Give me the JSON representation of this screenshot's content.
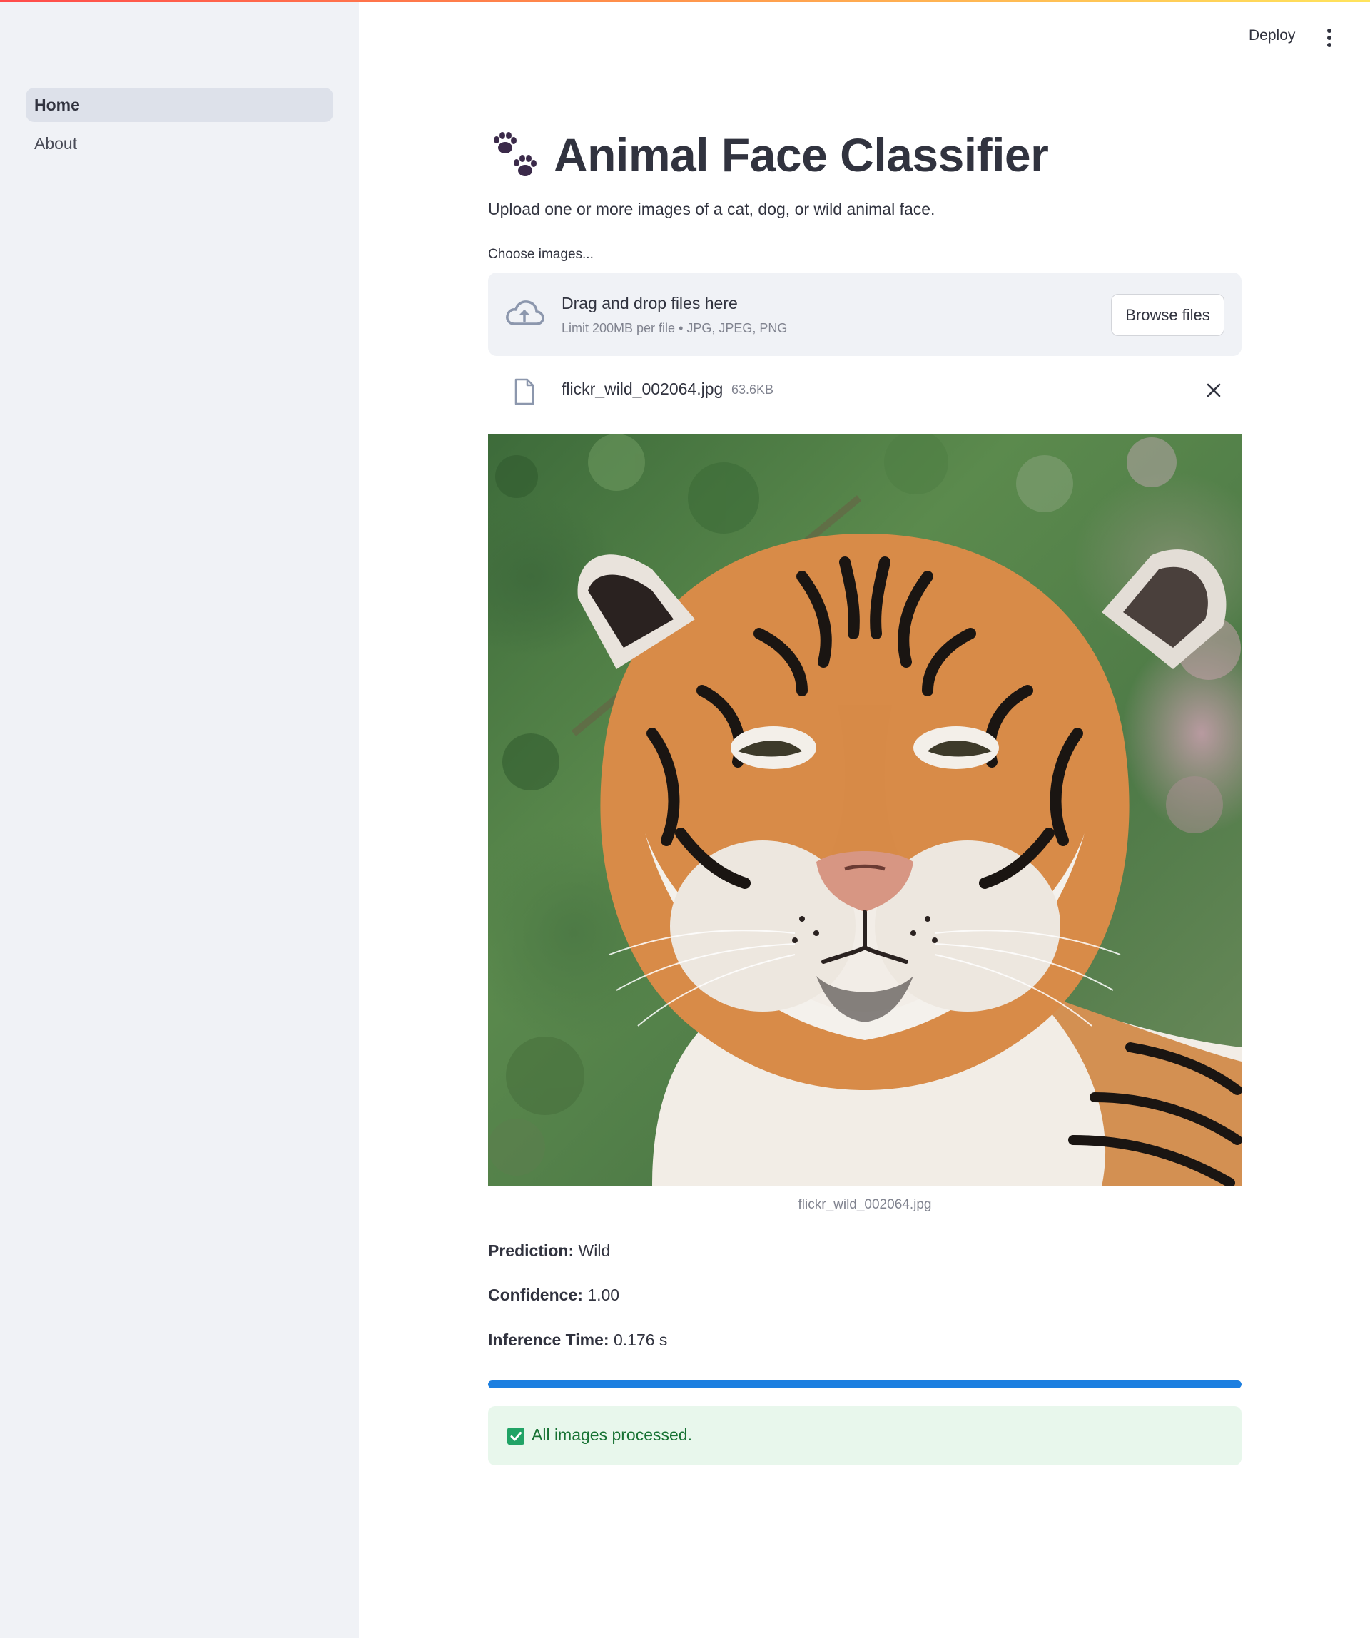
{
  "sidebar": {
    "items": [
      {
        "label": "Home",
        "active": true
      },
      {
        "label": "About",
        "active": false
      }
    ]
  },
  "header": {
    "deploy_label": "Deploy",
    "menu_icon": "kebab-menu-icon"
  },
  "main": {
    "title": "Animal Face Classifier",
    "title_icon": "paw-prints-icon",
    "subtitle": "Upload one or more images of a cat, dog, or wild animal face.",
    "uploader": {
      "label": "Choose images...",
      "drop_title": "Drag and drop files here",
      "limit_text": "Limit 200MB per file • JPG, JPEG, PNG",
      "browse_label": "Browse files",
      "icon": "cloud-upload-icon"
    },
    "file": {
      "name": "flickr_wild_002064.jpg",
      "size": "63.6KB",
      "icon": "file-icon",
      "remove_icon": "close-icon"
    },
    "image": {
      "caption": "flickr_wild_002064.jpg"
    },
    "results": {
      "prediction_label": "Prediction:",
      "prediction_value": "Wild",
      "confidence_label": "Confidence:",
      "confidence_value": "1.00",
      "inference_label": "Inference Time:",
      "inference_value": "0.176 s"
    },
    "progress": {
      "fraction": 1.0,
      "color": "#1c7fe0"
    },
    "status": {
      "text": "All images processed.",
      "icon": "check-box-icon",
      "color": "#177233"
    }
  },
  "colors": {
    "sidebar_bg": "#f0f2f6",
    "text": "#31333f",
    "muted": "#80838f",
    "success_bg": "#e8f7ec"
  }
}
